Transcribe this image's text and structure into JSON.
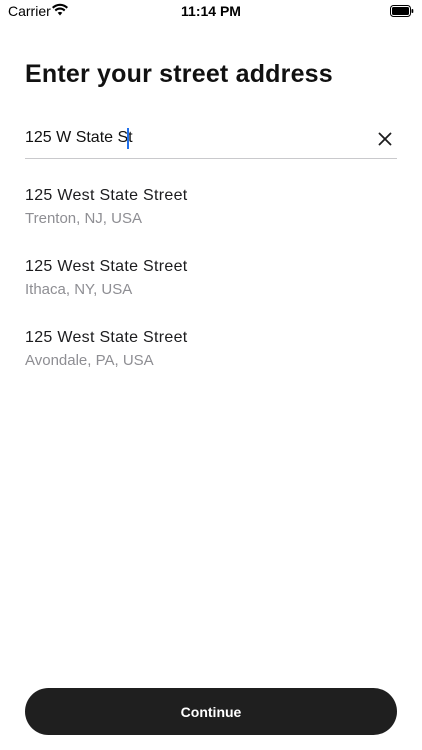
{
  "status_bar": {
    "carrier": "Carrier",
    "time": "11:14 PM",
    "wifi_icon": "wifi-icon",
    "battery_icon": "battery-full-icon"
  },
  "page": {
    "title": "Enter your street address"
  },
  "search": {
    "value": "125 W State St",
    "clear_icon": "close-icon"
  },
  "suggestions": [
    {
      "street": "125 West State Street",
      "city": "Trenton, NJ, USA"
    },
    {
      "street": "125 West State Street",
      "city": "Ithaca, NY, USA"
    },
    {
      "street": "125 West State Street",
      "city": "Avondale, PA, USA"
    }
  ],
  "footer": {
    "continue_label": "Continue"
  },
  "colors": {
    "accent_caret": "#1f6feb",
    "button_bg": "#1f1f1f",
    "secondary_text": "#8e8e93"
  }
}
